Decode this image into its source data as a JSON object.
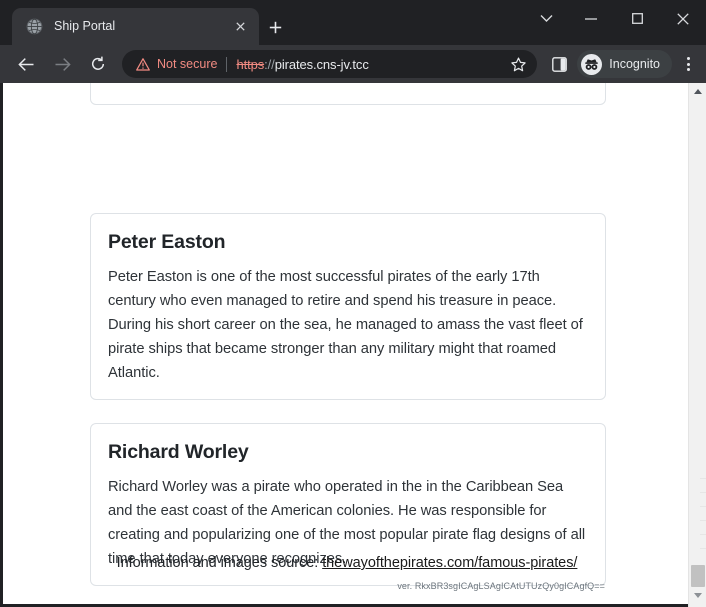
{
  "window": {
    "controls": {
      "tab_search": "tab-search-chevron",
      "minimize": "—",
      "maximize": "□",
      "close": "✕"
    }
  },
  "tabstrip": {
    "tabs": [
      {
        "title": "Ship Portal",
        "favicon": "globe-icon",
        "close_label": "✕",
        "active": true
      }
    ],
    "new_tab_label": "+"
  },
  "toolbar": {
    "back_label": "←",
    "forward_label": "→",
    "reload_label": "⟳",
    "security": {
      "icon": "warning-triangle-icon",
      "text": "Not secure"
    },
    "url": {
      "scheme": "https",
      "separator": "://",
      "host": "pirates.cns-jv.tcc",
      "full": "https://pirates.cns-jv.tcc"
    },
    "bookmark_label": "☆",
    "side_panel_label": "side-panel-icon",
    "profile": {
      "label": "Incognito",
      "avatar": "incognito-spy-icon"
    },
    "menu_label": "three-dot-menu"
  },
  "page": {
    "cards": [
      {
        "id": "partial-card-top",
        "title": "",
        "body": ""
      },
      {
        "id": "peter-easton",
        "title": "Peter Easton",
        "body": "Peter Easton is one of the most successful pirates of the early 17th century who even managed to retire and spend his treasure in peace. During his short career on the sea, he managed to amass the vast fleet of pirate ships that became stronger than any military might that roamed Atlantic."
      },
      {
        "id": "richard-worley",
        "title": "Richard Worley",
        "body": "Richard Worley was a pirate who operated in the in the Caribbean Sea and the east coast of the American colonies. He was responsible for creating and popularizing one of the most popular pirate flag designs of all time that today everyone recognizes."
      }
    ],
    "footer": {
      "prefix": "Information and images source: ",
      "link_text": "thewayofthepirates.com/famous-pirates/",
      "version": "ver. RkxBR3sgICAgLSAgICAtUTUzQy0gICAgfQ=="
    }
  },
  "scrollbar": {
    "up_arrow": "scroll-up-arrow",
    "down_arrow": "scroll-down-arrow",
    "thumb": "scroll-thumb"
  },
  "colors": {
    "chrome_bg": "#202124",
    "toolbar_bg": "#35363a",
    "omnibox_bg": "#202124",
    "danger": "#f28b82",
    "page_bg": "#ffffff",
    "card_border": "#dee2e6",
    "text": "#212529"
  }
}
